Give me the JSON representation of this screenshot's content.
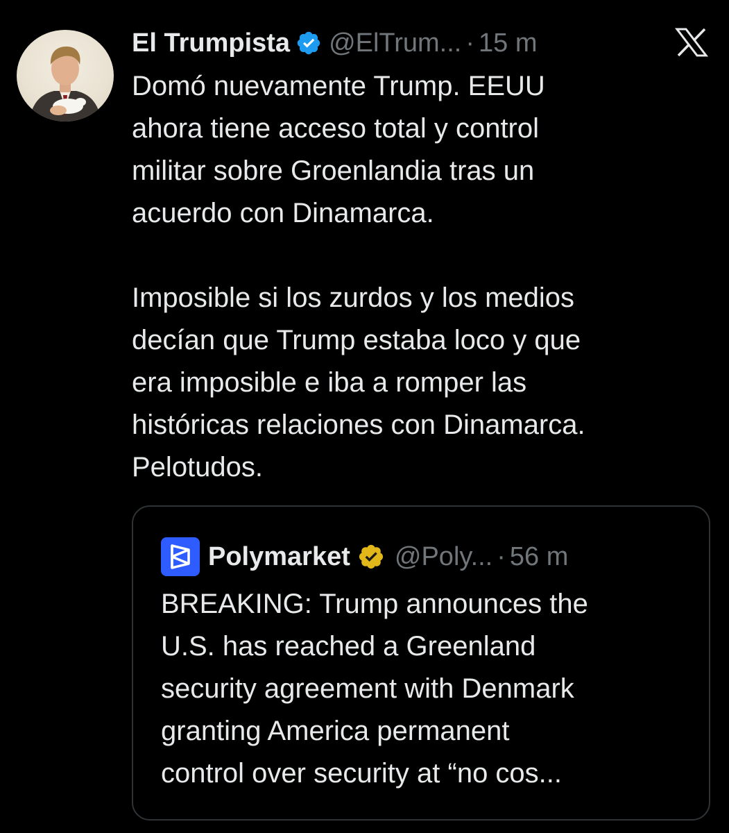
{
  "tweet": {
    "author_name": "El Trumpista",
    "handle": "@ElTrum...",
    "separator": "·",
    "time": "15 m",
    "text": "Domó nuevamente Trump. EEUU\nahora tiene acceso total y control\nmilitar sobre Groenlandia tras un\nacuerdo con Dinamarca.\n\nImposible si los zurdos y los medios\ndecían que Trump estaba loco y que\nera imposible e iba a romper las\nhistóricas relaciones con Dinamarca.\nPelotudos.",
    "verified_icon": "blue-verified-badge-icon",
    "platform_icon": "x-logo-icon"
  },
  "quoted_tweet": {
    "author_name": "Polymarket",
    "handle": "@Poly...",
    "separator": "·",
    "time": "56 m",
    "text": "BREAKING: Trump announces the\nU.S. has reached a Greenland\nsecurity agreement with Denmark\ngranting America permanent\ncontrol over security at “no cos...",
    "logo_icon": "polymarket-logo-icon",
    "verified_icon": "gold-verified-badge-icon"
  },
  "colors": {
    "background": "#000000",
    "primary_text": "#e7e9ea",
    "secondary_text": "#71767b",
    "border": "#2f3336",
    "verified_blue": "#1d9bf0",
    "verified_gold": "#e2b719",
    "polymarket_blue": "#2e5cff"
  }
}
